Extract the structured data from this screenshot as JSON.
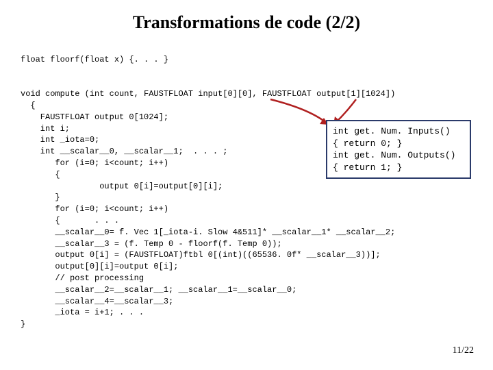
{
  "title": "Transformations de code (2/2)",
  "code": {
    "l1": "float floorf(float x) {. . . }",
    "l2": "",
    "l3": "void compute (int count, FAUSTFLOAT input[0][0], FAUSTFLOAT output[1][1024])",
    "l4": "  {",
    "l5": "    FAUSTFLOAT output 0[1024];",
    "l6": "    int i;",
    "l7": "    int _iota=0;",
    "l8": "    int __scalar__0, __scalar__1;  . . . ;",
    "l9": "       for (i=0; i<count; i++)",
    "l10": "       {",
    "l11": "                output 0[i]=output[0][i];",
    "l12": "       }",
    "l13": "       for (i=0; i<count; i++)",
    "l14": "       {       . . .",
    "l15": "       __scalar__0= f. Vec 1[_iota-i. Slow 4&511]* __scalar__1* __scalar__2;",
    "l16": "       __scalar__3 = (f. Temp 0 - floorf(f. Temp 0));",
    "l17": "       output 0[i] = (FAUSTFLOAT)ftbl 0[(int)((65536. 0f* __scalar__3))];",
    "l18": "       output[0][i]=output 0[i];",
    "l19": "       // post processing",
    "l20": "       __scalar__2=__scalar__1; __scalar__1=__scalar__0;",
    "l21": "       __scalar__4=__scalar__3;",
    "l22": "       _iota = i+1; . . .",
    "l23": "}"
  },
  "sidebox": {
    "s1": "int get. Num. Inputs()",
    "s2": "{ return 0; }",
    "s3": "int get. Num. Outputs()",
    "s4": "{ return 1; }"
  },
  "pagenum": "11/22"
}
